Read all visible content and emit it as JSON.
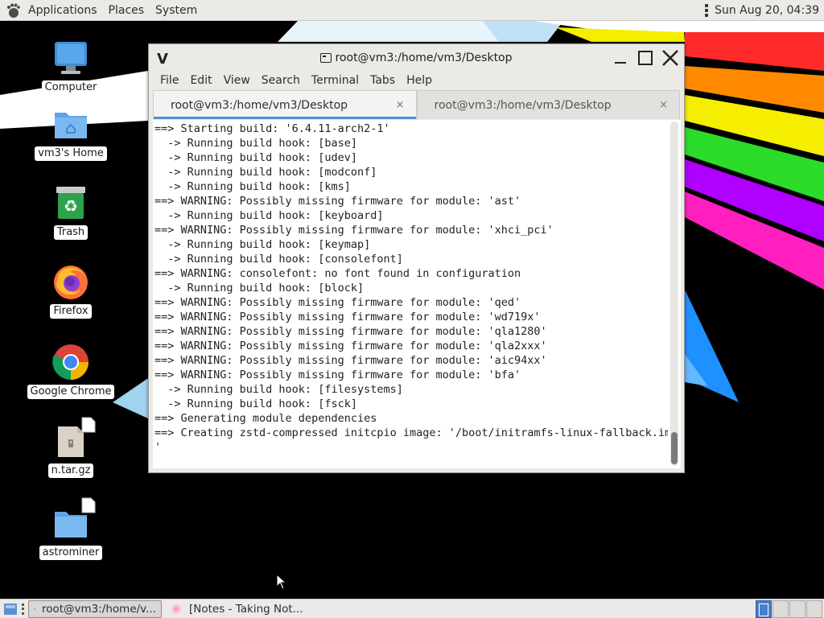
{
  "top_panel": {
    "menu": [
      "Applications",
      "Places",
      "System"
    ],
    "clock": "Sun Aug 20, 04:39"
  },
  "desktop_icons": [
    {
      "label": "Computer",
      "icon": "computer-icon"
    },
    {
      "label": "vm3's Home",
      "icon": "home-folder-icon"
    },
    {
      "label": "Trash",
      "icon": "trash-icon"
    },
    {
      "label": "Firefox",
      "icon": "firefox-icon"
    },
    {
      "label": "Google Chrome",
      "icon": "chrome-icon"
    },
    {
      "label": "n.tar.gz",
      "icon": "archive-file-icon"
    },
    {
      "label": "astrominer",
      "icon": "folder-icon"
    }
  ],
  "terminal": {
    "title": "root@vm3:/home/vm3/Desktop",
    "menu": [
      "File",
      "Edit",
      "View",
      "Search",
      "Terminal",
      "Tabs",
      "Help"
    ],
    "tabs": [
      {
        "label": "root@vm3:/home/vm3/Desktop",
        "active": true
      },
      {
        "label": "root@vm3:/home/vm3/Desktop",
        "active": false
      }
    ],
    "tab_close": "×",
    "lines": [
      "==> Starting build: '6.4.11-arch2-1'",
      "  -> Running build hook: [base]",
      "  -> Running build hook: [udev]",
      "  -> Running build hook: [modconf]",
      "  -> Running build hook: [kms]",
      "==> WARNING: Possibly missing firmware for module: 'ast'",
      "  -> Running build hook: [keyboard]",
      "==> WARNING: Possibly missing firmware for module: 'xhci_pci'",
      "  -> Running build hook: [keymap]",
      "  -> Running build hook: [consolefont]",
      "==> WARNING: consolefont: no font found in configuration",
      "  -> Running build hook: [block]",
      "==> WARNING: Possibly missing firmware for module: 'qed'",
      "==> WARNING: Possibly missing firmware for module: 'wd719x'",
      "==> WARNING: Possibly missing firmware for module: 'qla1280'",
      "==> WARNING: Possibly missing firmware for module: 'qla2xxx'",
      "==> WARNING: Possibly missing firmware for module: 'aic94xx'",
      "==> WARNING: Possibly missing firmware for module: 'bfa'",
      "  -> Running build hook: [filesystems]",
      "  -> Running build hook: [fsck]",
      "==> Generating module dependencies",
      "==> Creating zstd-compressed initcpio image: '/boot/initramfs-linux-fallback.img",
      "'"
    ]
  },
  "bottom_panel": {
    "tasks": [
      {
        "label": "root@vm3:/home/v...",
        "active": true
      },
      {
        "label": "[Notes - Taking Not...",
        "active": false
      }
    ],
    "workspace_count": 4,
    "active_workspace": 1
  },
  "colors": {
    "panel_bg": "#eceae7",
    "accent": "#4a90d9",
    "terminal_bg": "#ffffff"
  }
}
